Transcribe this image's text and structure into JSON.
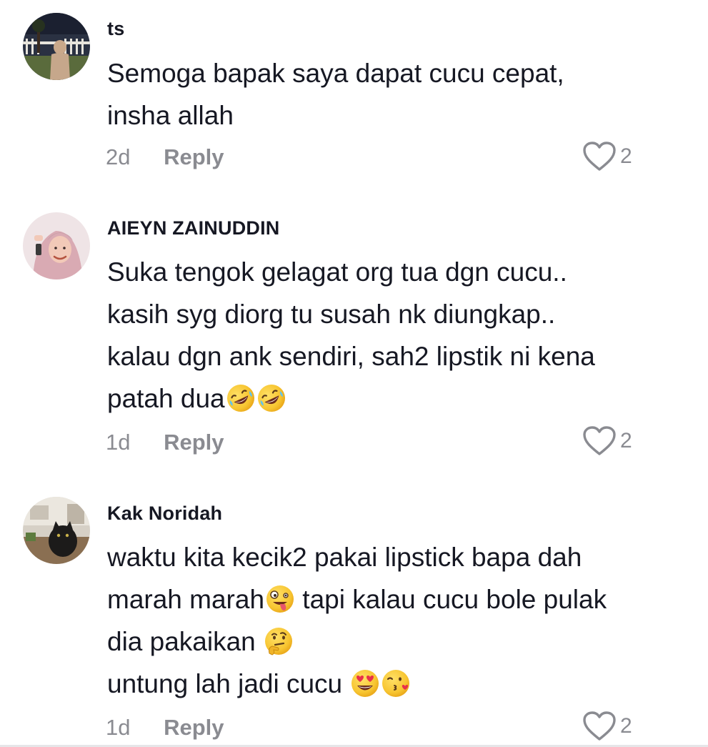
{
  "comments": [
    {
      "username": "ts",
      "lines": [
        "Semoga bapak saya dapat cucu cepat,",
        "insha allah"
      ],
      "time": "2d",
      "reply": "Reply",
      "likes": "2"
    },
    {
      "username": "AIEYN ZAINUDDIN",
      "lines": [
        "Suka tengok gelagat org tua dgn cucu..",
        "kasih syg diorg tu susah nk diungkap..",
        "kalau dgn ank sendiri, sah2 lipstik ni kena",
        "patah dua"
      ],
      "time": "1d",
      "reply": "Reply",
      "likes": "2"
    },
    {
      "username": "Kak Noridah",
      "lines": [
        "waktu kita kecik2 pakai lipstick bapa dah",
        "marah marah",
        " tapi kalau cucu bole pulak",
        "dia pakaikan ",
        "untung lah jadi cucu "
      ],
      "time": "1d",
      "reply": "Reply",
      "likes": "2"
    }
  ],
  "icons": {
    "like": "heart-outline-icon",
    "emoji_laugh": "rolling-on-floor-laughing-emoji",
    "emoji_zany": "zany-face-emoji",
    "emoji_thinking": "thinking-face-emoji",
    "emoji_heart_eyes": "heart-eyes-emoji",
    "emoji_kiss": "face-blowing-kiss-emoji"
  },
  "colors": {
    "text": "#161823",
    "meta": "#8a8b91",
    "emoji_yellow": "#f7c531"
  }
}
